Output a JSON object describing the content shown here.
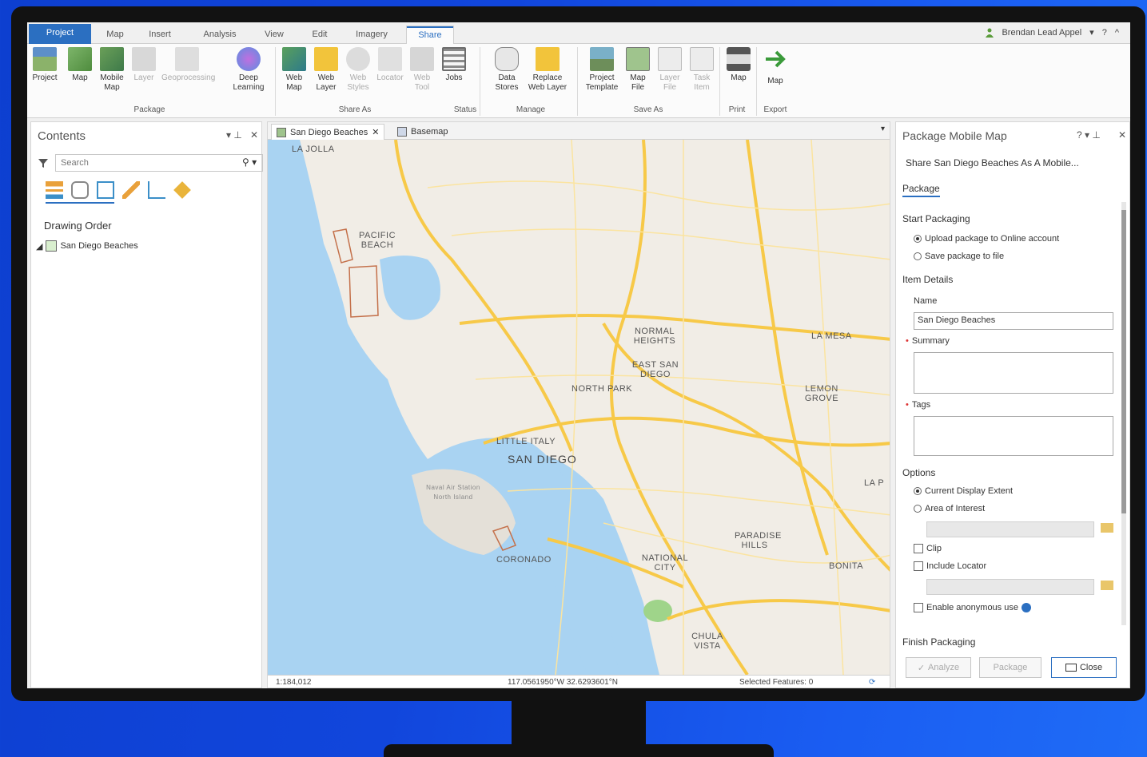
{
  "ribbon_tabs": [
    "Project",
    "Map",
    "Insert",
    "Analysis",
    "View",
    "Edit",
    "Imagery",
    "Share"
  ],
  "active_tab": "Share",
  "user": {
    "name": "Brendan Lead Appel",
    "dropdown": "▾",
    "help": "?",
    "collapse": "^"
  },
  "ribbon": {
    "package_group": {
      "label": "Package",
      "buttons": [
        "Project",
        "Map",
        "Mobile Map",
        "Layer",
        "Geoprocessing",
        "Deep Learning"
      ]
    },
    "share_as_group": {
      "label": "Share As",
      "buttons": [
        "Web Map",
        "Web Layer",
        "Web Styles",
        "Locator",
        "Web Tool",
        "Jobs"
      ]
    },
    "status_group": {
      "label": "Status"
    },
    "manage_group": {
      "label": "Manage",
      "buttons": [
        "Data Stores",
        "Replace Web Layer"
      ]
    },
    "save_as_group": {
      "label": "Save As",
      "buttons": [
        "Project Template",
        "Map File",
        "Layer File",
        "Task Item"
      ]
    },
    "print_group": {
      "label": "Print",
      "buttons": [
        "Map"
      ]
    },
    "export_group": {
      "label": "Export",
      "buttons": [
        "Map"
      ]
    }
  },
  "contents": {
    "title": "Contents",
    "search_placeholder": "Search",
    "drawing_order": "Drawing Order",
    "layer": "San Diego Beaches"
  },
  "map": {
    "tabs": [
      "San Diego Beaches",
      "Basemap"
    ],
    "places": [
      "LA JOLLA",
      "PACIFIC BEACH",
      "NORMAL HEIGHTS",
      "EAST SAN DIEGO",
      "NORTH PARK",
      "LA MESA",
      "LEMON GROVE",
      "LITTLE ITALY",
      "SAN DIEGO",
      "CORONADO",
      "NATIONAL CITY",
      "PARADISE HILLS",
      "BONITA",
      "CHULA VISTA",
      "Naval Air Station North Island",
      "LA P"
    ],
    "status": {
      "scale": "1:184,012",
      "coords": "117.0561950°W 32.6293601°N",
      "selected": "Selected Features: 0"
    }
  },
  "package_pane": {
    "title": "Package Mobile Map",
    "subtitle": "Share San Diego Beaches As A Mobile...",
    "tab": "Package",
    "start_packaging": "Start Packaging",
    "option_upload": "Upload package to Online account",
    "option_save": "Save package to file",
    "item_details": "Item Details",
    "name_label": "Name",
    "name_value": "San Diego Beaches",
    "summary_label": "Summary",
    "tags_label": "Tags",
    "options": "Options",
    "opt_extent": "Current Display Extent",
    "opt_aoi": "Area of Interest",
    "clip": "Clip",
    "include_locator": "Include Locator",
    "anon": "Enable anonymous use",
    "finish": "Finish Packaging",
    "analyze_btn": "Analyze",
    "package_btn": "Package",
    "close_btn": "Close"
  },
  "colors": {
    "accent": "#2b6fc1",
    "road": "#f7c948",
    "water": "#a9d3f2",
    "land": "#f1ede6"
  }
}
